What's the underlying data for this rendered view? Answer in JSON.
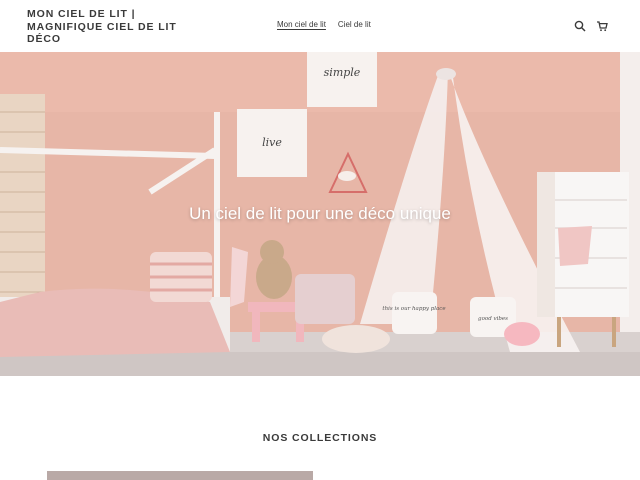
{
  "header": {
    "logo_text": "MON CIEL DE LIT | MAGNIFIQUE CIEL DE LIT DÉCO",
    "nav": [
      {
        "label": "Mon ciel de lit",
        "active": true
      },
      {
        "label": "Ciel de lit",
        "active": false
      }
    ],
    "icons": [
      "search-icon",
      "cart-icon"
    ]
  },
  "hero": {
    "title": "Un ciel de lit pour une déco unique",
    "frame_text_1": "simple",
    "frame_text_2": "live",
    "pillow_text_1": "this is our happy place",
    "pillow_text_2": "good vibes"
  },
  "collections": {
    "title": "NOS COLLECTIONS"
  },
  "colors": {
    "wall": "#e8b7a8",
    "floor": "#d8cfcd",
    "text": "#3a3a3a"
  }
}
